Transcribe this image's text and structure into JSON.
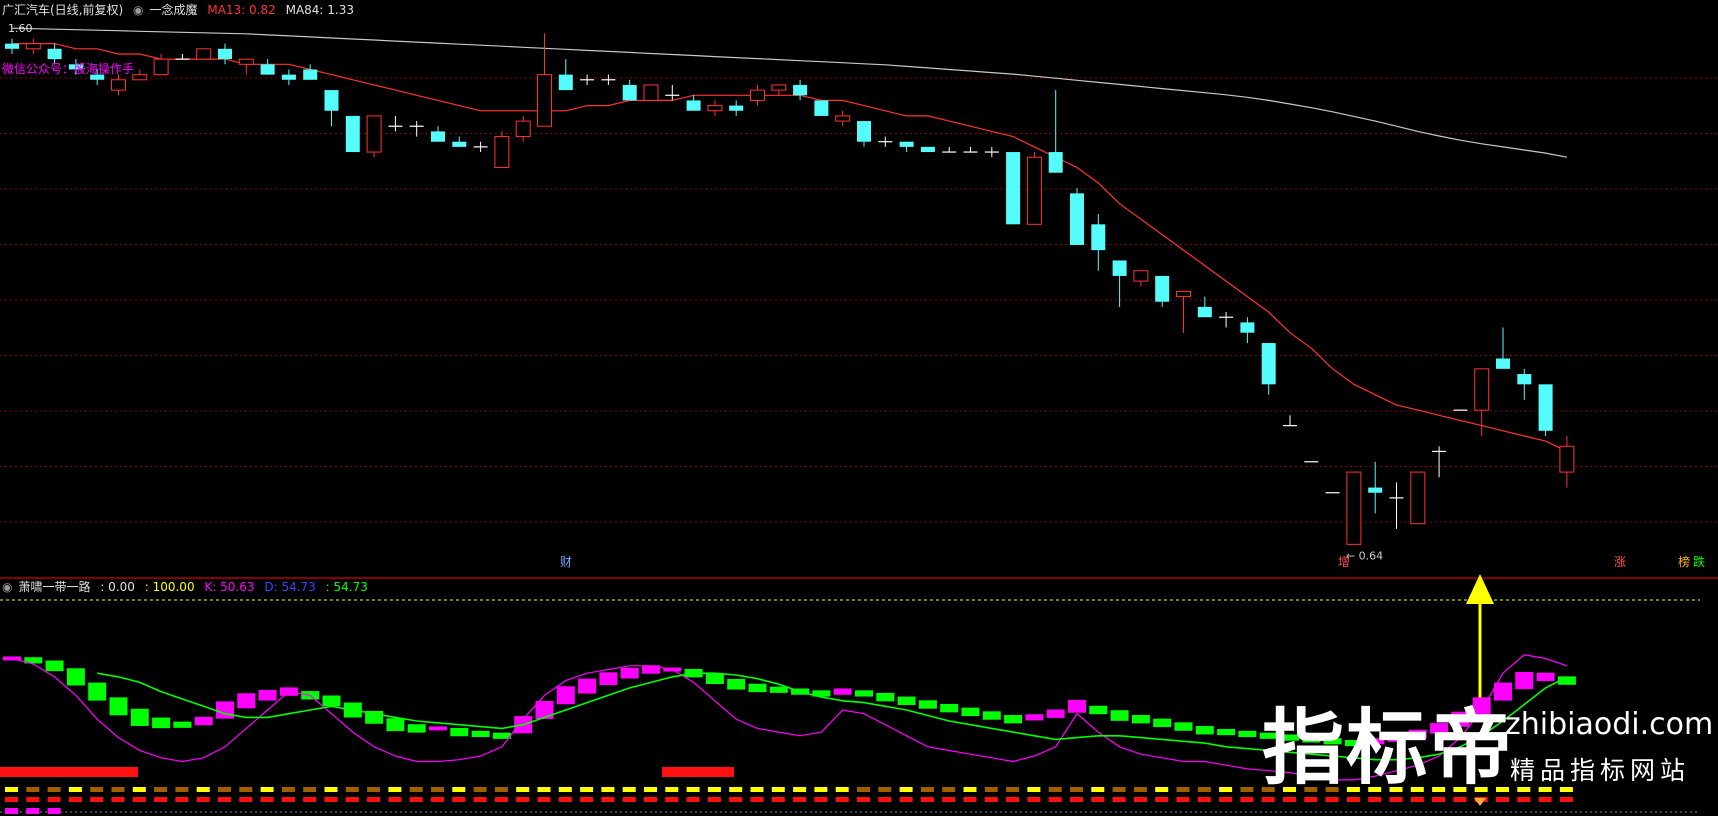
{
  "colors": {
    "background": "#000000",
    "up": "#ff3232",
    "down": "#54fcfc",
    "ma13": "#ff3232",
    "ma84": "#c8c8c8",
    "grid": "#8b0000",
    "k": "#ff00ff",
    "d": "#4040ff",
    "j": "#00ff00",
    "yellow": "#ffff00",
    "magenta": "#ff00ff",
    "green": "#00ff00"
  },
  "main_panel": {
    "stock_title": "广汇汽车(日线,前复权)",
    "indicator_name": "一念成魔",
    "ma13_label": "MA13: 0.82",
    "ma84_label": "MA84: 1.33",
    "top_price_label": "1.60",
    "wechat_text": "微信公众号：股海操作手",
    "low_label": "0.64",
    "event_tags": [
      {
        "text": "财",
        "color": "#6fa8ff"
      },
      {
        "text": "增",
        "color": "#ff5050"
      },
      {
        "text": "涨",
        "color": "#ff5050"
      },
      {
        "text": "榜",
        "color": "#ffb000"
      },
      {
        "text": "跌",
        "color": "#00ff00"
      }
    ]
  },
  "sub_panel": {
    "indicator_name": "萧啸一带一路",
    "value_0": ": 0.00",
    "value_100": ": 100.00",
    "k_label": "K: 50.63",
    "d_label": "D: 54.73",
    "j_label": ": 54.73"
  },
  "watermark": {
    "main": "指标帝",
    "url": "zhibiaodi.com",
    "sub": "精品指标网站"
  },
  "chart_data": {
    "type": "candlestick",
    "price_range": [
      0.6,
      1.65
    ],
    "candles": [
      [
        1.61,
        1.62,
        1.59,
        1.6
      ],
      [
        1.6,
        1.62,
        1.59,
        1.61
      ],
      [
        1.6,
        1.61,
        1.57,
        1.58
      ],
      [
        1.57,
        1.58,
        1.55,
        1.56
      ],
      [
        1.55,
        1.56,
        1.53,
        1.54
      ],
      [
        1.52,
        1.55,
        1.51,
        1.54
      ],
      [
        1.54,
        1.56,
        1.54,
        1.55
      ],
      [
        1.55,
        1.59,
        1.55,
        1.58
      ],
      [
        1.58,
        1.59,
        1.58,
        1.58
      ],
      [
        1.58,
        1.6,
        1.58,
        1.6
      ],
      [
        1.6,
        1.61,
        1.57,
        1.58
      ],
      [
        1.57,
        1.58,
        1.55,
        1.58
      ],
      [
        1.57,
        1.58,
        1.55,
        1.55
      ],
      [
        1.55,
        1.56,
        1.53,
        1.54
      ],
      [
        1.56,
        1.57,
        1.54,
        1.54
      ],
      [
        1.52,
        1.52,
        1.45,
        1.48
      ],
      [
        1.47,
        1.47,
        1.4,
        1.4
      ],
      [
        1.4,
        1.47,
        1.39,
        1.47
      ],
      [
        1.45,
        1.47,
        1.44,
        1.45
      ],
      [
        1.45,
        1.46,
        1.43,
        1.45
      ],
      [
        1.44,
        1.45,
        1.42,
        1.42
      ],
      [
        1.42,
        1.43,
        1.41,
        1.41
      ],
      [
        1.41,
        1.42,
        1.4,
        1.41
      ],
      [
        1.37,
        1.44,
        1.37,
        1.43
      ],
      [
        1.43,
        1.47,
        1.42,
        1.46
      ],
      [
        1.45,
        1.63,
        1.45,
        1.55
      ],
      [
        1.55,
        1.58,
        1.52,
        1.52
      ],
      [
        1.54,
        1.55,
        1.53,
        1.54
      ],
      [
        1.54,
        1.55,
        1.53,
        1.54
      ],
      [
        1.53,
        1.54,
        1.5,
        1.5
      ],
      [
        1.5,
        1.53,
        1.5,
        1.53
      ],
      [
        1.51,
        1.53,
        1.5,
        1.51
      ],
      [
        1.5,
        1.51,
        1.48,
        1.48
      ],
      [
        1.48,
        1.5,
        1.47,
        1.49
      ],
      [
        1.49,
        1.5,
        1.47,
        1.48
      ],
      [
        1.5,
        1.53,
        1.49,
        1.52
      ],
      [
        1.52,
        1.53,
        1.51,
        1.53
      ],
      [
        1.53,
        1.54,
        1.5,
        1.51
      ],
      [
        1.5,
        1.5,
        1.47,
        1.47
      ],
      [
        1.46,
        1.48,
        1.45,
        1.47
      ],
      [
        1.46,
        1.46,
        1.41,
        1.42
      ],
      [
        1.42,
        1.43,
        1.41,
        1.42
      ],
      [
        1.42,
        1.42,
        1.4,
        1.41
      ],
      [
        1.41,
        1.41,
        1.4,
        1.4
      ],
      [
        1.4,
        1.41,
        1.4,
        1.4
      ],
      [
        1.4,
        1.41,
        1.4,
        1.4
      ],
      [
        1.4,
        1.41,
        1.39,
        1.4
      ],
      [
        1.4,
        1.4,
        1.26,
        1.26
      ],
      [
        1.26,
        1.4,
        1.26,
        1.39
      ],
      [
        1.4,
        1.52,
        1.36,
        1.36
      ],
      [
        1.32,
        1.33,
        1.22,
        1.22
      ],
      [
        1.26,
        1.28,
        1.17,
        1.21
      ],
      [
        1.19,
        1.19,
        1.1,
        1.16
      ],
      [
        1.15,
        1.17,
        1.14,
        1.17
      ],
      [
        1.16,
        1.16,
        1.1,
        1.11
      ],
      [
        1.12,
        1.13,
        1.05,
        1.13
      ],
      [
        1.1,
        1.12,
        1.09,
        1.08
      ],
      [
        1.08,
        1.09,
        1.06,
        1.08
      ],
      [
        1.07,
        1.08,
        1.03,
        1.05
      ],
      [
        1.03,
        1.03,
        0.93,
        0.95
      ],
      [
        0.87,
        0.89,
        0.87,
        0.87
      ],
      [
        0.8,
        0.8,
        0.8,
        0.8
      ],
      [
        0.74,
        0.74,
        0.74,
        0.74
      ],
      [
        0.64,
        0.78,
        0.64,
        0.78
      ],
      [
        0.75,
        0.8,
        0.7,
        0.74
      ],
      [
        0.73,
        0.76,
        0.67,
        0.73
      ],
      [
        0.68,
        0.78,
        0.68,
        0.78
      ],
      [
        0.82,
        0.83,
        0.77,
        0.82
      ],
      [
        0.9,
        0.9,
        0.9,
        0.9
      ],
      [
        0.9,
        0.98,
        0.85,
        0.98
      ],
      [
        1.0,
        1.06,
        0.98,
        0.98
      ],
      [
        0.97,
        0.98,
        0.92,
        0.95
      ],
      [
        0.95,
        0.95,
        0.85,
        0.86
      ],
      [
        0.78,
        0.85,
        0.75,
        0.83
      ]
    ],
    "ma13": [
      1.61,
      1.61,
      1.61,
      1.6,
      1.6,
      1.59,
      1.59,
      1.58,
      1.58,
      1.58,
      1.58,
      1.57,
      1.57,
      1.57,
      1.56,
      1.55,
      1.54,
      1.53,
      1.52,
      1.51,
      1.5,
      1.49,
      1.48,
      1.48,
      1.48,
      1.48,
      1.48,
      1.49,
      1.49,
      1.5,
      1.5,
      1.5,
      1.51,
      1.51,
      1.51,
      1.51,
      1.51,
      1.51,
      1.5,
      1.5,
      1.49,
      1.48,
      1.47,
      1.47,
      1.46,
      1.45,
      1.44,
      1.43,
      1.41,
      1.39,
      1.37,
      1.34,
      1.3,
      1.27,
      1.24,
      1.21,
      1.18,
      1.15,
      1.12,
      1.09,
      1.05,
      1.02,
      0.98,
      0.95,
      0.93,
      0.91,
      0.9,
      0.89,
      0.88,
      0.87,
      0.86,
      0.85,
      0.84,
      0.82
    ],
    "ma84": [
      1.64,
      1.639,
      1.638,
      1.637,
      1.636,
      1.635,
      1.634,
      1.633,
      1.632,
      1.631,
      1.63,
      1.629,
      1.627,
      1.625,
      1.623,
      1.621,
      1.619,
      1.617,
      1.615,
      1.613,
      1.611,
      1.609,
      1.607,
      1.605,
      1.603,
      1.601,
      1.599,
      1.597,
      1.595,
      1.593,
      1.591,
      1.589,
      1.587,
      1.585,
      1.583,
      1.581,
      1.579,
      1.577,
      1.575,
      1.573,
      1.571,
      1.569,
      1.566,
      1.563,
      1.56,
      1.557,
      1.554,
      1.551,
      1.547,
      1.543,
      1.539,
      1.535,
      1.531,
      1.527,
      1.523,
      1.519,
      1.515,
      1.511,
      1.506,
      1.5,
      1.493,
      1.486,
      1.478,
      1.469,
      1.46,
      1.45,
      1.44,
      1.431,
      1.423,
      1.416,
      1.41,
      1.404,
      1.398,
      1.39
    ],
    "k_line": [
      78,
      75,
      68,
      58,
      45,
      35,
      28,
      24,
      22,
      24,
      30,
      40,
      50,
      60,
      58,
      48,
      38,
      30,
      25,
      22,
      22,
      23,
      25,
      30,
      45,
      58,
      66,
      70,
      72,
      74,
      74,
      72,
      65,
      55,
      45,
      40,
      38,
      36,
      38,
      50,
      48,
      42,
      36,
      30,
      28,
      26,
      24,
      22,
      25,
      30,
      48,
      38,
      30,
      26,
      24,
      22,
      22,
      20,
      18,
      17,
      16,
      14,
      12,
      12,
      14,
      17,
      20,
      25,
      35,
      50,
      70,
      80,
      78,
      74
    ],
    "d_line": [
      null,
      null,
      null,
      null,
      70,
      68,
      65,
      60,
      56,
      52,
      48,
      46,
      46,
      48,
      50,
      52,
      50,
      48,
      46,
      44,
      43,
      42,
      41,
      40,
      42,
      46,
      50,
      54,
      58,
      62,
      65,
      68,
      70,
      70,
      69,
      67,
      64,
      60,
      57,
      55,
      54,
      52,
      50,
      47,
      44,
      42,
      40,
      38,
      36,
      34,
      35,
      36,
      36,
      35,
      34,
      33,
      32,
      30,
      29,
      28,
      27,
      26,
      25,
      24,
      23,
      23,
      24,
      26,
      30,
      36,
      44,
      53,
      62,
      68
    ],
    "bars": [
      78,
      77,
      74,
      68,
      60,
      52,
      46,
      43,
      42,
      44,
      50,
      55,
      58,
      60,
      58,
      55,
      50,
      46,
      42,
      40,
      40,
      38,
      37,
      36,
      42,
      50,
      58,
      63,
      67,
      70,
      72,
      72,
      70,
      67,
      64,
      62,
      61,
      60,
      59,
      60,
      59,
      57,
      55,
      53,
      51,
      49,
      47,
      45,
      46,
      48,
      52,
      50,
      47,
      45,
      43,
      41,
      39,
      38,
      37,
      36,
      35,
      34,
      33,
      32,
      33,
      35,
      37,
      40,
      45,
      52,
      60,
      66,
      68,
      66
    ]
  }
}
